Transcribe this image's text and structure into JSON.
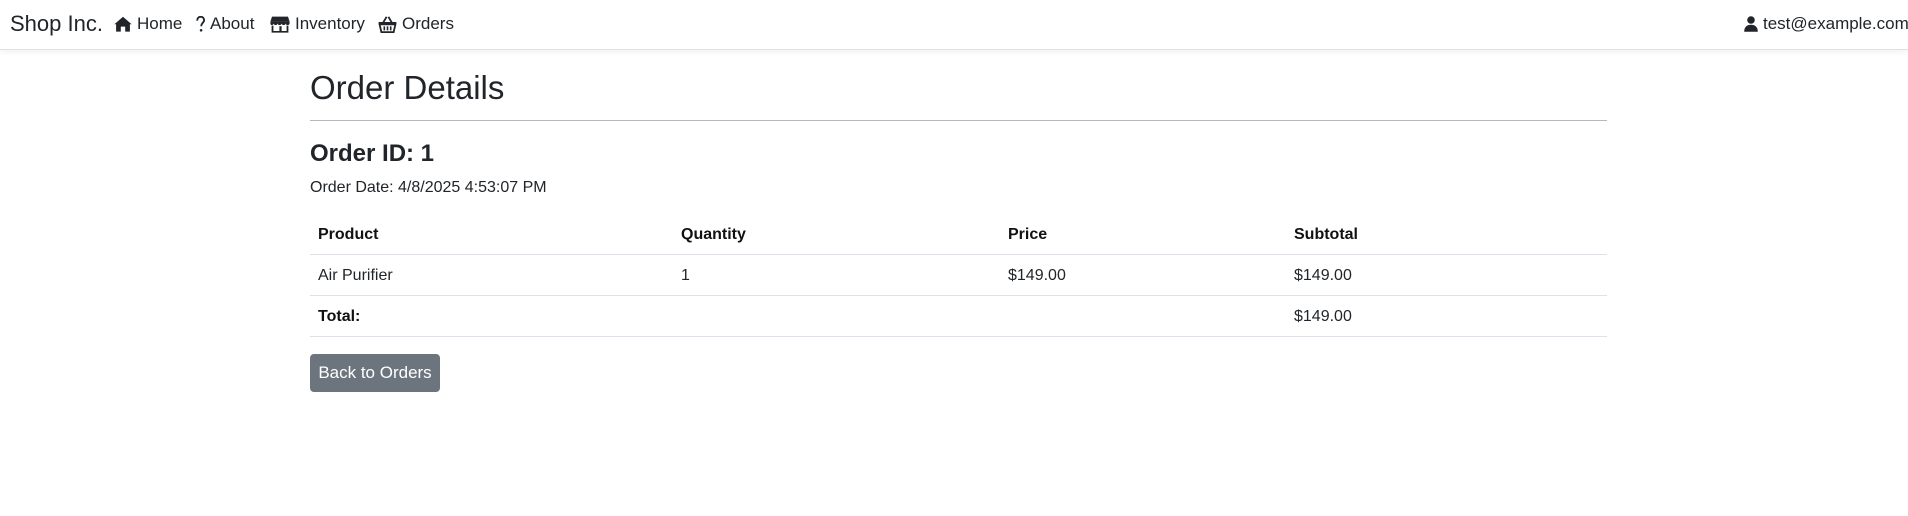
{
  "navbar": {
    "brand": "Shop Inc.",
    "items": [
      {
        "label": "Home",
        "icon": "home-icon"
      },
      {
        "label": "About",
        "icon": "question-icon"
      },
      {
        "label": "Inventory",
        "icon": "shop-icon"
      },
      {
        "label": "Orders",
        "icon": "basket-icon"
      }
    ],
    "user": {
      "label": "test@example.com",
      "icon": "person-icon"
    }
  },
  "page": {
    "title": "Order Details",
    "order_id": "Order ID: 1",
    "order_date": "Order Date: 4/8/2025 4:53:07 PM"
  },
  "table": {
    "headers": [
      "Product",
      "Quantity",
      "Price",
      "Subtotal"
    ],
    "rows": [
      {
        "product": "Air Purifier",
        "quantity": "1",
        "price": "$149.00",
        "subtotal": "$149.00"
      }
    ],
    "total_label": "Total:",
    "total_value": "$149.00"
  },
  "actions": {
    "back_label": "Back to Orders"
  },
  "colors": {
    "button_bg": "#6c757d",
    "text": "#212529",
    "border": "#dee2e6"
  }
}
